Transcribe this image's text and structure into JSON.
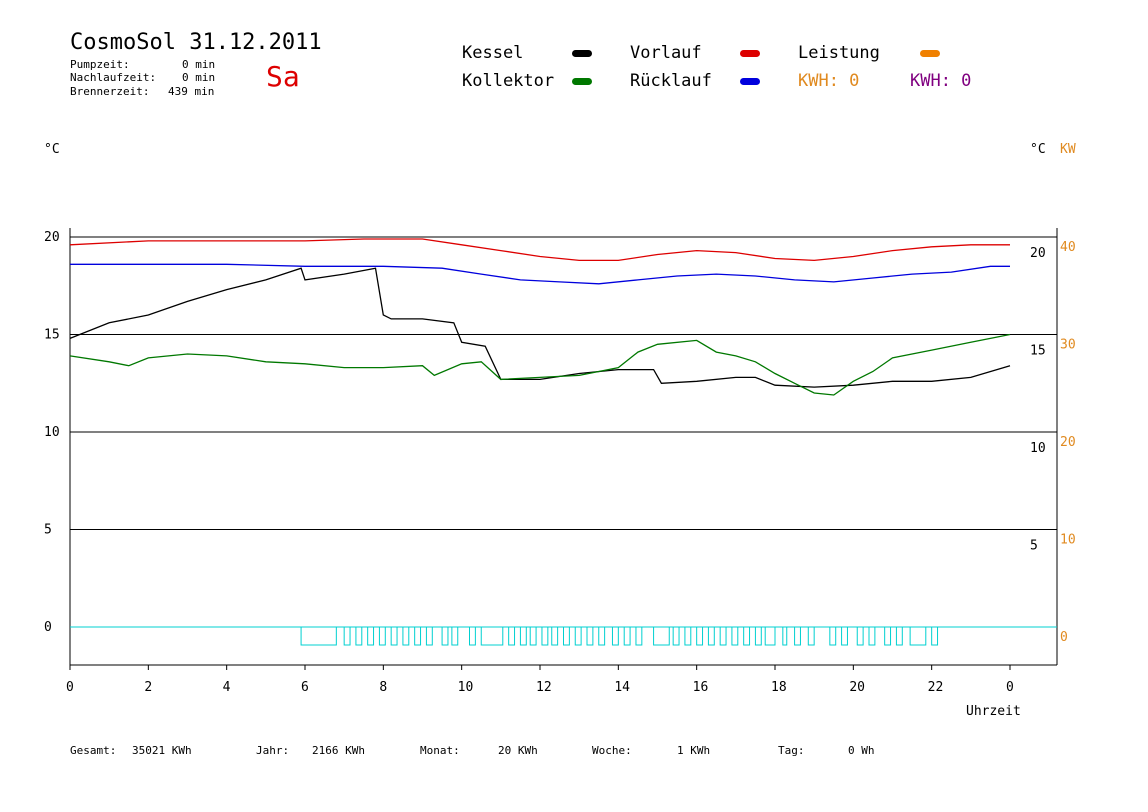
{
  "header": {
    "title": "CosmoSol 31.12.2011",
    "day": "Sa",
    "pumpzeit_label": "Pumpzeit:",
    "pumpzeit_value": "0 min",
    "nachlaufzeit_label": "Nachlaufzeit:",
    "nachlaufzeit_value": "0 min",
    "brennerzeit_label": "Brennerzeit:",
    "brennerzeit_value": "439 min"
  },
  "legend": {
    "kessel": "Kessel",
    "kollektor": "Kollektor",
    "vorlauf": "Vorlauf",
    "ruecklauf": "Rücklauf",
    "leistung": "Leistung",
    "kwh_orange": "KWH: 0",
    "kwh_purple": "KWH: 0"
  },
  "units": {
    "left": "°C",
    "right_c": "°C",
    "right_kw": "KW"
  },
  "footer": {
    "gesamt_label": "Gesamt:",
    "gesamt_value": "35021 KWh",
    "jahr_label": "Jahr:",
    "jahr_value": "2166 KWh",
    "monat_label": "Monat:",
    "monat_value": "20 KWh",
    "woche_label": "Woche:",
    "woche_value": "1 KWh",
    "tag_label": "Tag:",
    "tag_value": "0 Wh"
  },
  "colors": {
    "kessel": "#000000",
    "kollektor": "#007800",
    "vorlauf": "#dd0000",
    "ruecklauf": "#0000dd",
    "leistung": "#f08000",
    "kwh_purple": "#800080",
    "pump": "#00d0d0"
  },
  "chart_data": {
    "type": "line",
    "xlabel": "Uhrzeit",
    "x_ticks": [
      "0",
      "2",
      "4",
      "6",
      "8",
      "10",
      "12",
      "14",
      "16",
      "18",
      "20",
      "22",
      "0"
    ],
    "xlim": [
      0,
      24
    ],
    "y_left_ticks": [
      "20",
      "15",
      "10",
      "5",
      "0"
    ],
    "y_right_ticks": [
      "20",
      "15",
      "10",
      "5"
    ],
    "y_kw_ticks": [
      "40",
      "30",
      "20",
      "10",
      "0"
    ],
    "ylim": [
      0,
      20
    ],
    "ylim_kw": [
      0,
      40
    ],
    "grid": "horizontal",
    "series": [
      {
        "name": "Vorlauf",
        "color": "#dd0000",
        "x": [
          0,
          2,
          4,
          6,
          7.5,
          9,
          10,
          11,
          12,
          13,
          14,
          15,
          16,
          17,
          18,
          19,
          20,
          21,
          22,
          23,
          24
        ],
        "y": [
          19.6,
          19.8,
          19.8,
          19.8,
          19.9,
          19.9,
          19.6,
          19.3,
          19.0,
          18.8,
          18.8,
          19.1,
          19.3,
          19.2,
          18.9,
          18.8,
          19.0,
          19.3,
          19.5,
          19.6,
          19.6
        ]
      },
      {
        "name": "Rücklauf",
        "color": "#0000dd",
        "x": [
          0,
          2,
          4,
          6,
          8,
          9.5,
          10.5,
          11.5,
          12.5,
          13.5,
          14.5,
          15.5,
          16.5,
          17.5,
          18.5,
          19.5,
          20.5,
          21.5,
          22.5,
          23.5,
          24
        ],
        "y": [
          18.6,
          18.6,
          18.6,
          18.5,
          18.5,
          18.4,
          18.1,
          17.8,
          17.7,
          17.6,
          17.8,
          18.0,
          18.1,
          18.0,
          17.8,
          17.7,
          17.9,
          18.1,
          18.2,
          18.5,
          18.5
        ]
      },
      {
        "name": "Kessel",
        "color": "#000000",
        "x": [
          0,
          1,
          2,
          3,
          4,
          5,
          5.9,
          6.0,
          7,
          7.8,
          8.0,
          8.2,
          9,
          9.8,
          10.0,
          10.6,
          11.0,
          12,
          13,
          14,
          14.9,
          15.1,
          16,
          17,
          17.5,
          18,
          19,
          20,
          21,
          22,
          23,
          24
        ],
        "y": [
          14.8,
          15.6,
          16.0,
          16.7,
          17.3,
          17.8,
          18.4,
          17.8,
          18.1,
          18.4,
          16.0,
          15.8,
          15.8,
          15.6,
          14.6,
          14.4,
          12.7,
          12.7,
          13.0,
          13.2,
          13.2,
          12.5,
          12.6,
          12.8,
          12.8,
          12.4,
          12.3,
          12.4,
          12.6,
          12.6,
          12.8,
          13.4
        ]
      },
      {
        "name": "Kollektor",
        "color": "#007800",
        "x": [
          0,
          1,
          1.5,
          2,
          3,
          4,
          5,
          6,
          7,
          8,
          9,
          9.3,
          10,
          10.5,
          11,
          12,
          13,
          14,
          14.5,
          15,
          16,
          16.5,
          17,
          17.5,
          18,
          18.5,
          19,
          19.5,
          20,
          20.5,
          21,
          22,
          23,
          24
        ],
        "y": [
          13.9,
          13.6,
          13.4,
          13.8,
          14.0,
          13.9,
          13.6,
          13.5,
          13.3,
          13.3,
          13.4,
          12.9,
          13.5,
          13.6,
          12.7,
          12.8,
          12.9,
          13.3,
          14.1,
          14.5,
          14.7,
          14.1,
          13.9,
          13.6,
          13.0,
          12.5,
          12.0,
          11.9,
          12.6,
          13.1,
          13.8,
          14.2,
          14.6,
          15.0
        ]
      }
    ],
    "pump_intervals": [
      [
        5.9,
        6.8
      ],
      [
        7.0,
        7.15
      ],
      [
        7.3,
        7.45
      ],
      [
        7.6,
        7.75
      ],
      [
        7.9,
        8.05
      ],
      [
        8.2,
        8.35
      ],
      [
        8.5,
        8.65
      ],
      [
        8.8,
        8.95
      ],
      [
        9.1,
        9.25
      ],
      [
        9.5,
        9.65
      ],
      [
        9.75,
        9.9
      ],
      [
        10.2,
        10.35
      ],
      [
        10.5,
        11.05
      ],
      [
        11.2,
        11.35
      ],
      [
        11.5,
        11.65
      ],
      [
        11.75,
        11.9
      ],
      [
        12.05,
        12.2
      ],
      [
        12.3,
        12.45
      ],
      [
        12.6,
        12.75
      ],
      [
        12.9,
        13.05
      ],
      [
        13.2,
        13.35
      ],
      [
        13.5,
        13.65
      ],
      [
        13.85,
        14.0
      ],
      [
        14.15,
        14.3
      ],
      [
        14.45,
        14.6
      ],
      [
        14.9,
        15.3
      ],
      [
        15.4,
        15.55
      ],
      [
        15.7,
        15.85
      ],
      [
        16.0,
        16.15
      ],
      [
        16.3,
        16.45
      ],
      [
        16.6,
        16.75
      ],
      [
        16.9,
        17.05
      ],
      [
        17.2,
        17.35
      ],
      [
        17.5,
        17.65
      ],
      [
        17.75,
        18.0
      ],
      [
        18.2,
        18.3
      ],
      [
        18.5,
        18.65
      ],
      [
        18.85,
        19.0
      ],
      [
        19.4,
        19.55
      ],
      [
        19.7,
        19.85
      ],
      [
        20.1,
        20.25
      ],
      [
        20.4,
        20.55
      ],
      [
        20.8,
        20.95
      ],
      [
        21.1,
        21.25
      ],
      [
        21.45,
        21.85
      ],
      [
        22.0,
        22.15
      ]
    ]
  }
}
